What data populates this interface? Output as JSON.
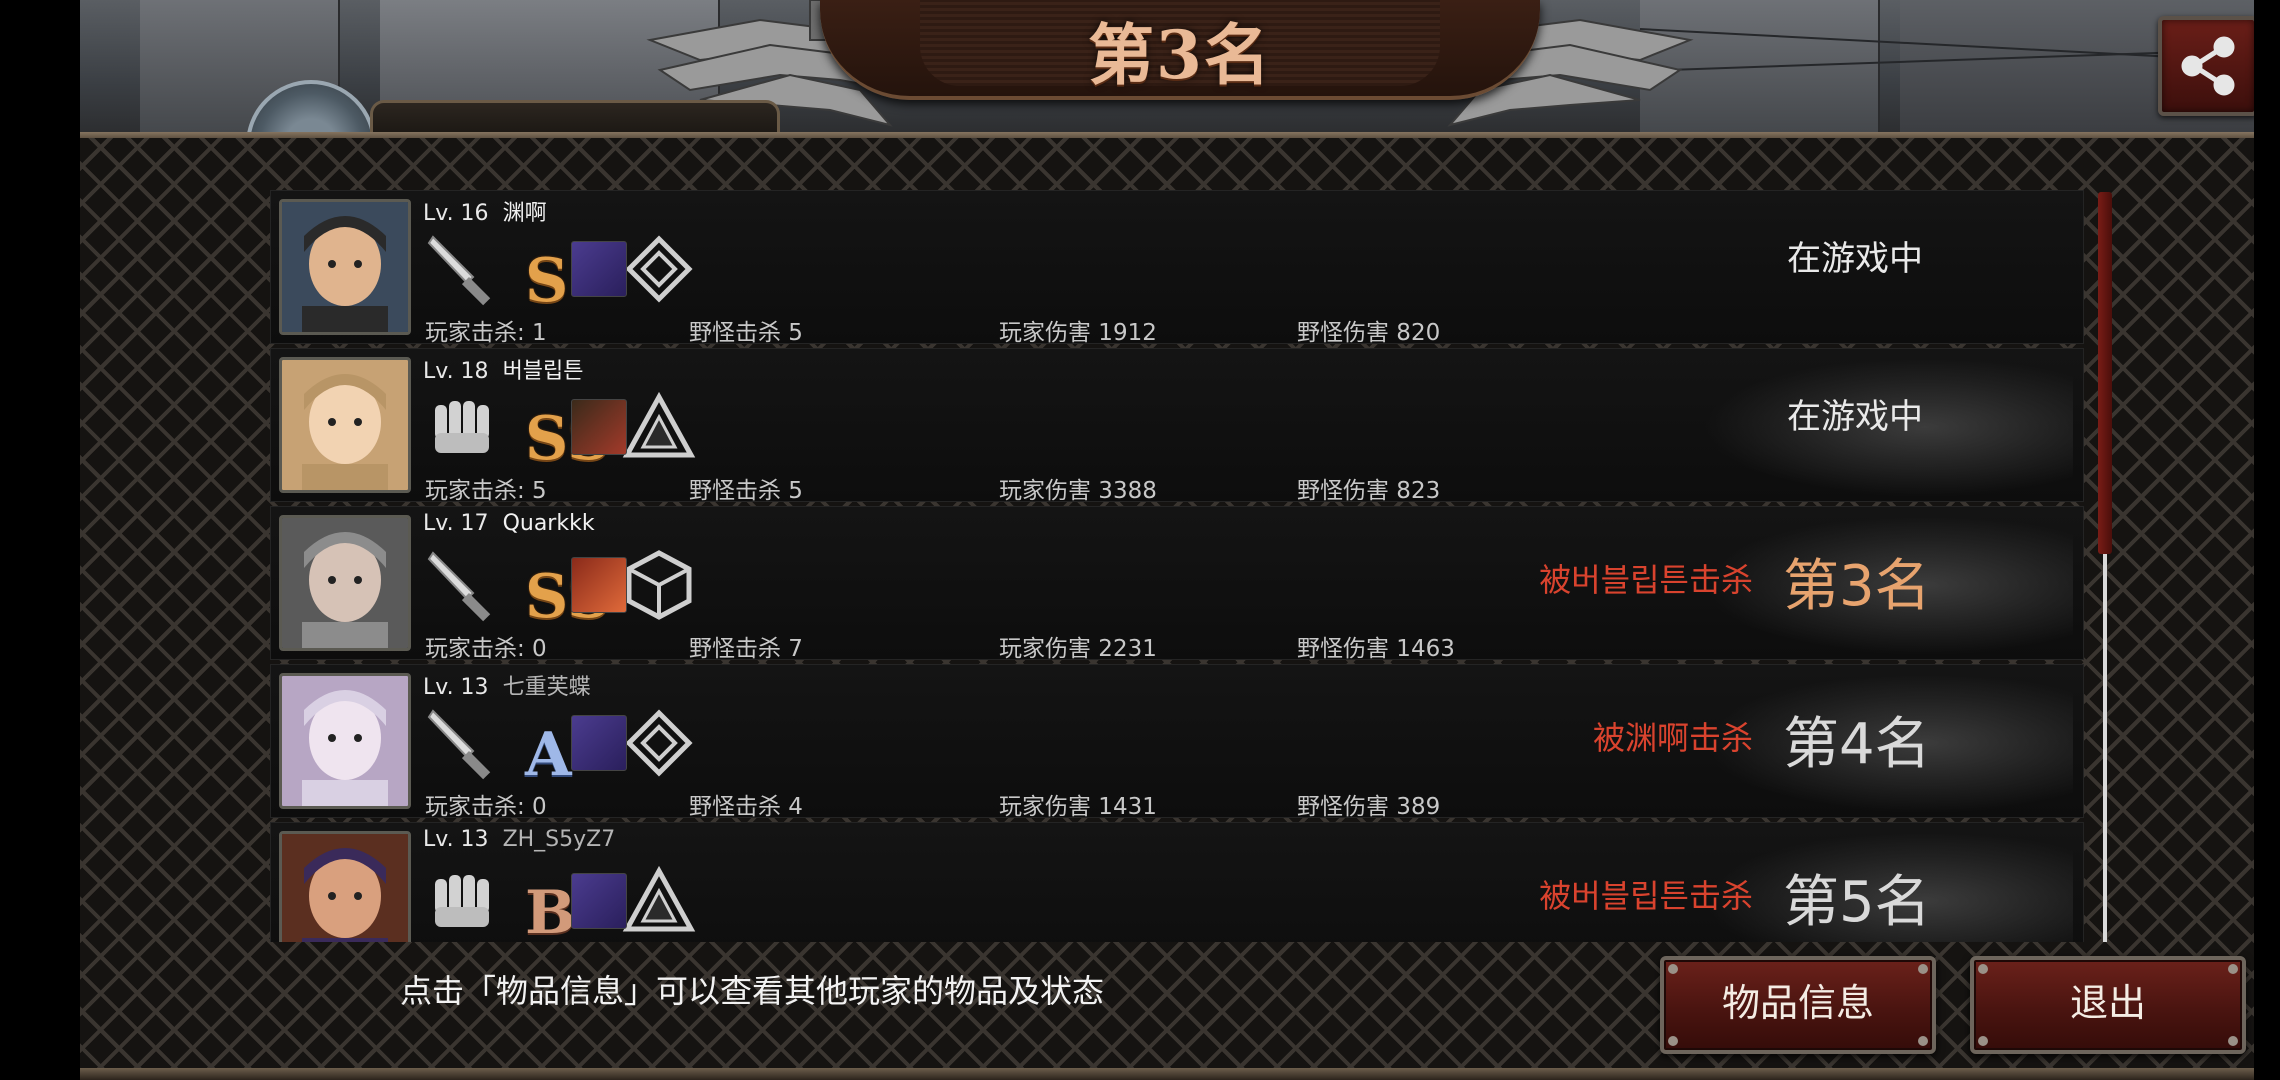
{
  "header": {
    "title": "第3名"
  },
  "hint": "点击「物品信息」可以查看其他玩家的物品及状态",
  "buttons": {
    "items": "物品信息",
    "exit": "退出"
  },
  "rows": [
    {
      "lv": "Lv. 16",
      "name": "渊啊",
      "weapon": "knife-icon",
      "grade": "S",
      "grade_sup": "",
      "kills": "玩家击杀: 1",
      "monster_kills": "野怪击杀 5",
      "player_damage": "玩家伤害 1912",
      "monster_damage": "野怪伤害 820",
      "status": "在游戏中",
      "killed_by": "",
      "rank": ""
    },
    {
      "lv": "Lv. 18",
      "name": "버블립튼",
      "weapon": "fist-icon",
      "grade": "SS",
      "grade_sup": "",
      "kills": "玩家击杀: 5",
      "monster_kills": "野怪击杀 5",
      "player_damage": "玩家伤害 3388",
      "monster_damage": "野怪伤害 823",
      "status": "在游戏中",
      "killed_by": "",
      "rank": ""
    },
    {
      "lv": "Lv. 17",
      "name": "Quarkkk",
      "weapon": "knife-icon",
      "grade": "SS",
      "grade_sup": "",
      "kills": "玩家击杀: 0",
      "monster_kills": "野怪击杀 7",
      "player_damage": "玩家伤害 2231",
      "monster_damage": "野怪伤害 1463",
      "status": "",
      "killed_by": "被버블립튼击杀",
      "rank": "第3名"
    },
    {
      "lv": "Lv. 13",
      "name": "七重芙蝶",
      "weapon": "knife-icon",
      "grade": "A",
      "grade_sup": "+",
      "kills": "玩家击杀: 0",
      "monster_kills": "野怪击杀 4",
      "player_damage": "玩家伤害 1431",
      "monster_damage": "野怪伤害 389",
      "status": "",
      "killed_by": "被渊啊击杀",
      "rank": "第4名"
    },
    {
      "lv": "Lv. 13",
      "name": "ZH_S5yZ7",
      "weapon": "fist-icon",
      "grade": "B",
      "grade_sup": "+",
      "kills": "",
      "monster_kills": "",
      "player_damage": "",
      "monster_damage": "",
      "status": "",
      "killed_by": "被버블립튼击杀",
      "rank": "第5名"
    }
  ],
  "colors": {
    "accent_red": "#d9432e",
    "rank_highlight": "#e7a36e",
    "button_red": "#5a1913"
  }
}
